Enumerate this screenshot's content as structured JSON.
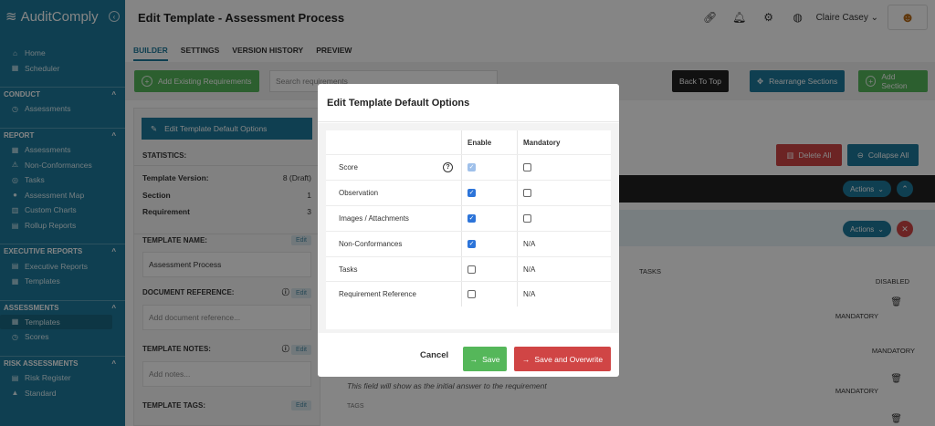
{
  "app": {
    "name": "AuditComply"
  },
  "sidebar": {
    "top_items": [
      {
        "label": "Home",
        "icon": "home-icon"
      },
      {
        "label": "Scheduler",
        "icon": "calendar-icon"
      }
    ],
    "sections": [
      {
        "title": "CONDUCT",
        "items": [
          "Assessments"
        ]
      },
      {
        "title": "REPORT",
        "items": [
          "Assessments",
          "Non-Conformances",
          "Tasks",
          "Assessment Map",
          "Custom Charts",
          "Rollup Reports"
        ]
      },
      {
        "title": "EXECUTIVE REPORTS",
        "items": [
          "Executive Reports",
          "Templates"
        ]
      },
      {
        "title": "ASSESSMENTS",
        "items": [
          "Templates",
          "Scores"
        ]
      },
      {
        "title": "RISK ASSESSMENTS",
        "items": [
          "Risk Register",
          "Standard"
        ]
      }
    ]
  },
  "header": {
    "title": "Edit Template - Assessment Process",
    "user": "Claire Casey"
  },
  "tabs": [
    "BUILDER",
    "SETTINGS",
    "VERSION HISTORY",
    "PREVIEW"
  ],
  "toolbar": {
    "add_existing": "Add Existing Requirements",
    "search_placeholder": "Search requirements",
    "back_to_top": "Back To Top",
    "rearrange": "Rearrange Sections",
    "add_section": "Add Section"
  },
  "left_panel": {
    "edit_defaults": "Edit Template Default Options",
    "statistics": "STATISTICS:",
    "stats": [
      {
        "label": "Template Version:",
        "value": "8 (Draft)"
      },
      {
        "label": "Section",
        "value": "1"
      },
      {
        "label": "Requirement",
        "value": "3"
      }
    ],
    "template_name_label": "TEMPLATE NAME:",
    "template_name": "Assessment Process",
    "doc_ref_label": "DOCUMENT REFERENCE:",
    "doc_ref_placeholder": "Add document reference...",
    "notes_label": "TEMPLATE NOTES:",
    "notes_placeholder": "Add notes...",
    "tags_label": "TEMPLATE TAGS:",
    "edit": "Edit"
  },
  "right_area": {
    "delete_all": "Delete All",
    "collapse_all": "Collapse All",
    "actions": "Actions",
    "tasks": "TASKS",
    "disabled": "DISABLED",
    "mandatory": "MANDATORY",
    "hint": "This field will show as the initial answer to the requirement",
    "tags": "TAGS"
  },
  "modal": {
    "title": "Edit Template Default Options",
    "col_enable": "Enable",
    "col_mandatory": "Mandatory",
    "rows": [
      {
        "label": "Score",
        "enable": "checked-disabled",
        "mandatory": "unchecked",
        "help": true
      },
      {
        "label": "Observation",
        "enable": "checked",
        "mandatory": "unchecked"
      },
      {
        "label": "Images / Attachments",
        "enable": "checked",
        "mandatory": "unchecked"
      },
      {
        "label": "Non-Conformances",
        "enable": "checked",
        "mandatory": "N/A"
      },
      {
        "label": "Tasks",
        "enable": "unchecked",
        "mandatory": "N/A"
      },
      {
        "label": "Requirement Reference",
        "enable": "unchecked",
        "mandatory": "N/A"
      }
    ],
    "cancel": "Cancel",
    "save": "Save",
    "save_overwrite": "Save and Overwrite"
  },
  "colors": {
    "primary": "#1d7a9b",
    "success": "#55b75a",
    "danger": "#d04545",
    "checkbox": "#2c74d9"
  }
}
